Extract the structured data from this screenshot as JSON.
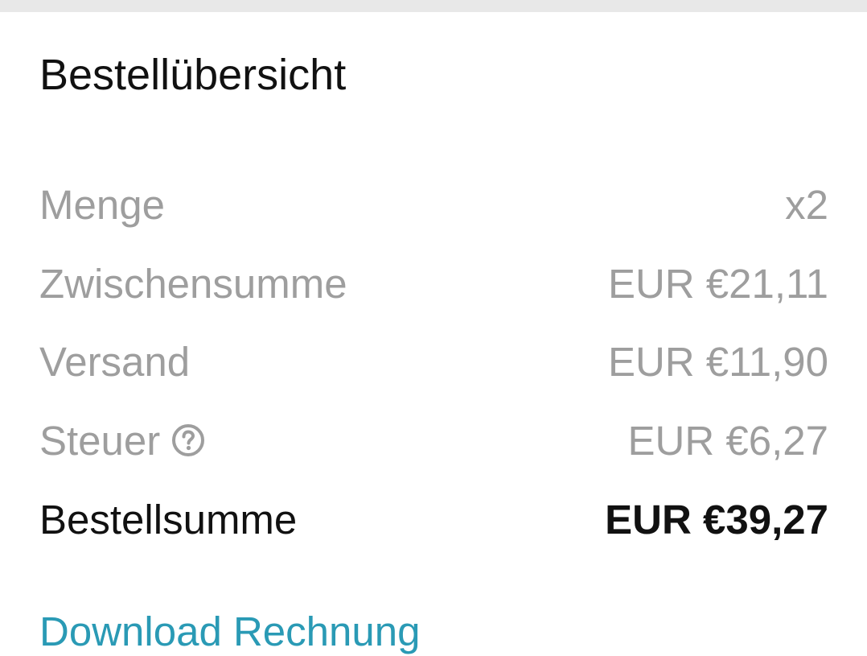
{
  "order_summary": {
    "title": "Bestellübersicht",
    "rows": [
      {
        "label": "Menge",
        "value": "x2"
      },
      {
        "label": "Zwischensumme",
        "value": "EUR €21,11"
      },
      {
        "label": "Versand",
        "value": "EUR €11,90"
      },
      {
        "label": "Steuer",
        "value": "EUR €6,27",
        "icon": "help-circle-icon"
      }
    ],
    "total": {
      "label": "Bestellsumme",
      "value": "EUR €39,27"
    },
    "link_label": "Download Rechnung"
  },
  "colors": {
    "background": "#ffffff",
    "top_strip": "#e8e8e8",
    "muted_text": "#9e9e9e",
    "primary_text": "#111111",
    "link": "#2a9ab5"
  }
}
